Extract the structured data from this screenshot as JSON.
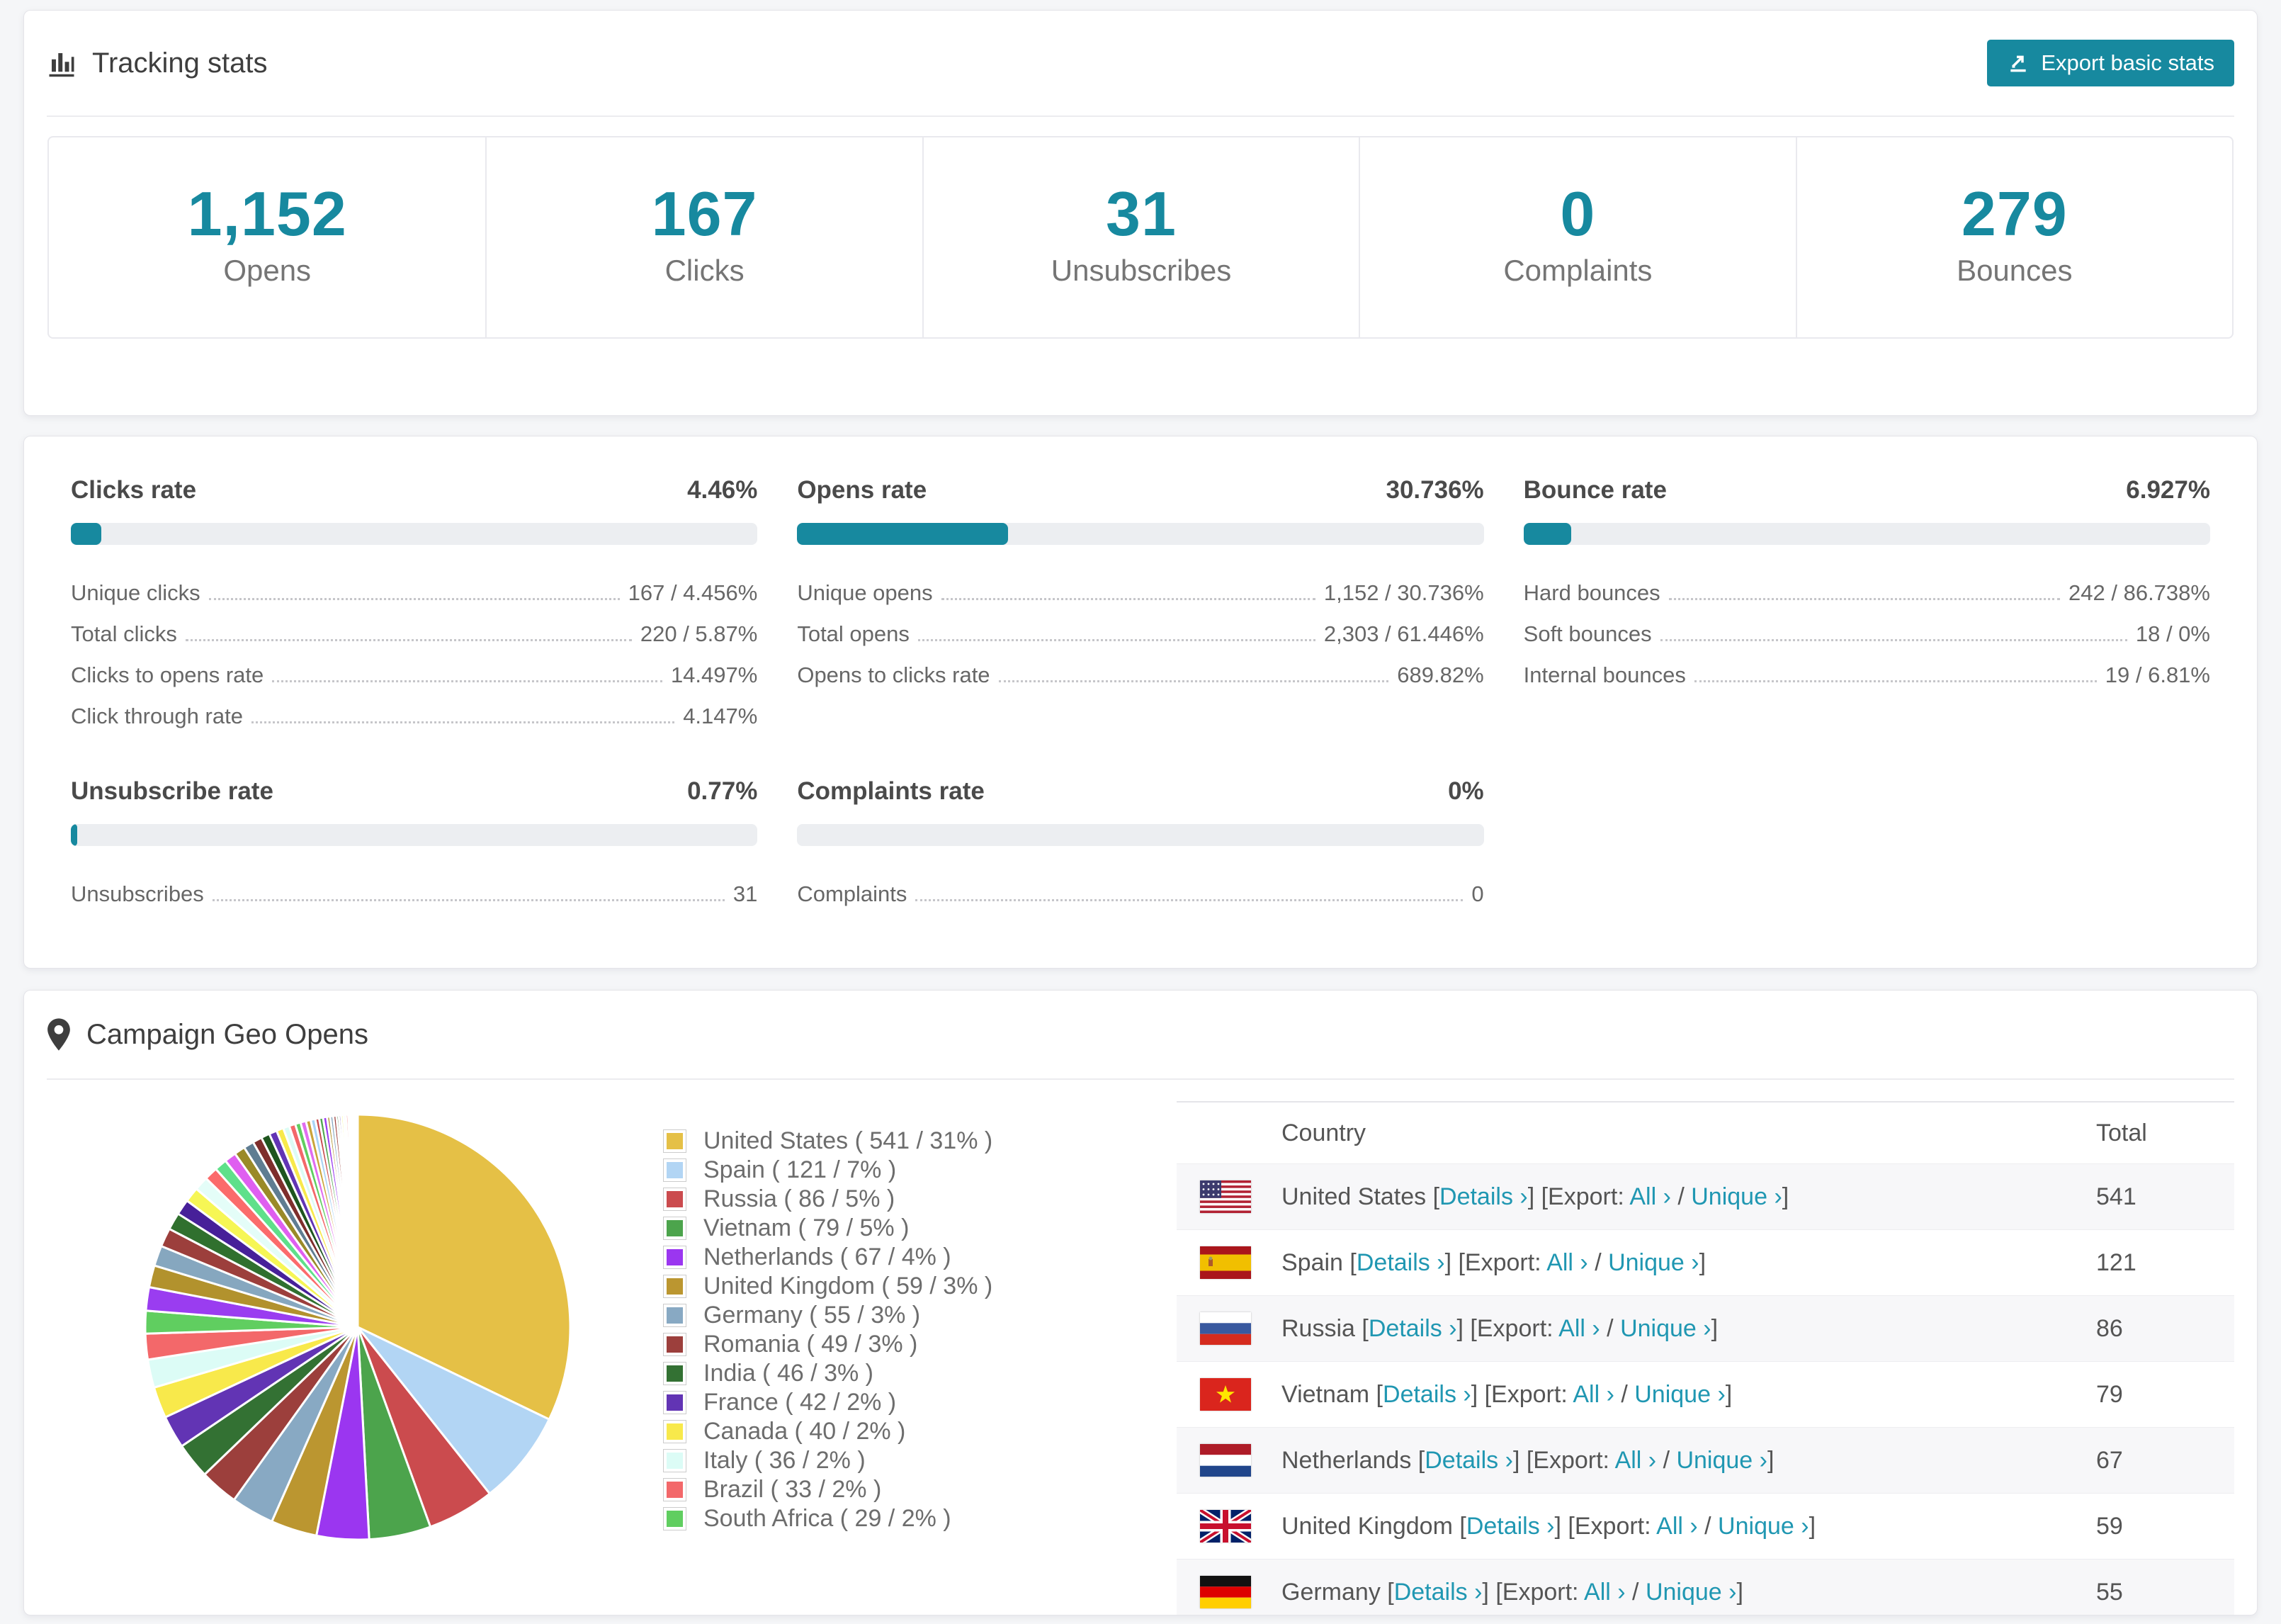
{
  "page": {
    "background": "#f5f6f8",
    "accent": "#17899f",
    "link_color": "#2097b2"
  },
  "tracking": {
    "title": "Tracking stats",
    "export_button": "Export basic stats",
    "stats": [
      {
        "value": "1,152",
        "label": "Opens"
      },
      {
        "value": "167",
        "label": "Clicks"
      },
      {
        "value": "31",
        "label": "Unsubscribes"
      },
      {
        "value": "0",
        "label": "Complaints"
      },
      {
        "value": "279",
        "label": "Bounces"
      }
    ]
  },
  "rates": {
    "row1": [
      {
        "id": "clicks",
        "title": "Clicks rate",
        "rate": "4.46%",
        "percent": 4.46,
        "rows": [
          {
            "label": "Unique clicks",
            "value": "167 / 4.456%"
          },
          {
            "label": "Total clicks",
            "value": "220 / 5.87%"
          },
          {
            "label": "Clicks to opens rate",
            "value": "14.497%"
          },
          {
            "label": "Click through rate",
            "value": "4.147%"
          }
        ]
      },
      {
        "id": "opens",
        "title": "Opens rate",
        "rate": "30.736%",
        "percent": 30.736,
        "rows": [
          {
            "label": "Unique opens",
            "value": "1,152 / 30.736%"
          },
          {
            "label": "Total opens",
            "value": "2,303 / 61.446%"
          },
          {
            "label": "Opens to clicks rate",
            "value": "689.82%"
          }
        ]
      },
      {
        "id": "bounce",
        "title": "Bounce rate",
        "rate": "6.927%",
        "percent": 6.927,
        "rows": [
          {
            "label": "Hard bounces",
            "value": "242 / 86.738%"
          },
          {
            "label": "Soft bounces",
            "value": "18 / 0%"
          },
          {
            "label": "Internal bounces",
            "value": "19 / 6.81%"
          }
        ]
      }
    ],
    "row2": [
      {
        "id": "unsubscribe",
        "title": "Unsubscribe rate",
        "rate": "0.77%",
        "percent": 0.77,
        "rows": [
          {
            "label": "Unsubscribes",
            "value": "31"
          }
        ]
      },
      {
        "id": "complaints",
        "title": "Complaints rate",
        "rate": "0%",
        "percent": 0,
        "rows": [
          {
            "label": "Complaints",
            "value": "0"
          }
        ]
      }
    ]
  },
  "geo": {
    "title": "Campaign Geo Opens",
    "table": {
      "headers": {
        "country": "Country",
        "total": "Total"
      },
      "details_label": "Details ›",
      "export_label": "Export:",
      "all_label": "All ›",
      "unique_label": "Unique ›",
      "rows": [
        {
          "flag": "us",
          "country": "United States",
          "total": "541"
        },
        {
          "flag": "es",
          "country": "Spain",
          "total": "121"
        },
        {
          "flag": "ru",
          "country": "Russia",
          "total": "86"
        },
        {
          "flag": "vn",
          "country": "Vietnam",
          "total": "79"
        },
        {
          "flag": "nl",
          "country": "Netherlands",
          "total": "67"
        },
        {
          "flag": "gb",
          "country": "United Kingdom",
          "total": "59"
        },
        {
          "flag": "de",
          "country": "Germany",
          "total": "55"
        }
      ]
    }
  },
  "chart_data": {
    "type": "pie",
    "title": "Campaign Geo Opens",
    "legend_position": "right",
    "start_angle_deg": -90,
    "countries": [
      {
        "label": "United States",
        "value": 541,
        "pct": "31%",
        "color": "#e5c046"
      },
      {
        "label": "Spain",
        "value": 121,
        "pct": "7%",
        "color": "#b2d5f4"
      },
      {
        "label": "Russia",
        "value": 86,
        "pct": "5%",
        "color": "#cb4b4e"
      },
      {
        "label": "Vietnam",
        "value": 79,
        "pct": "5%",
        "color": "#4ca44c"
      },
      {
        "label": "Netherlands",
        "value": 67,
        "pct": "4%",
        "color": "#9b36f0"
      },
      {
        "label": "United Kingdom",
        "value": 59,
        "pct": "3%",
        "color": "#bb9630"
      },
      {
        "label": "Germany",
        "value": 55,
        "pct": "3%",
        "color": "#88a9c3"
      },
      {
        "label": "Romania",
        "value": 49,
        "pct": "3%",
        "color": "#9c3f3c"
      },
      {
        "label": "India",
        "value": 46,
        "pct": "3%",
        "color": "#337133"
      },
      {
        "label": "France",
        "value": 42,
        "pct": "2%",
        "color": "#6234b4"
      },
      {
        "label": "Canada",
        "value": 40,
        "pct": "2%",
        "color": "#f8e94b"
      },
      {
        "label": "Italy",
        "value": 36,
        "pct": "2%",
        "color": "#dcfcf6"
      },
      {
        "label": "Brazil",
        "value": 33,
        "pct": "2%",
        "color": "#f3686a"
      },
      {
        "label": "South Africa",
        "value": 29,
        "pct": "2%",
        "color": "#60ce60"
      }
    ],
    "others": [
      {
        "color": "#9a3df0",
        "value": 30
      },
      {
        "color": "#b2922d",
        "value": 28
      },
      {
        "color": "#86a7bf",
        "value": 26
      },
      {
        "color": "#9c3f3c",
        "value": 24
      },
      {
        "color": "#30702e",
        "value": 22
      },
      {
        "color": "#472099",
        "value": 20
      },
      {
        "color": "#f6f655",
        "value": 19
      },
      {
        "color": "#e4fdf8",
        "value": 18
      },
      {
        "color": "#fb6b6b",
        "value": 17
      },
      {
        "color": "#5fe08a",
        "value": 16
      },
      {
        "color": "#df5ff0",
        "value": 15
      },
      {
        "color": "#9a8a28",
        "value": 14
      },
      {
        "color": "#5f7d92",
        "value": 13
      },
      {
        "color": "#7e2e2c",
        "value": 12
      },
      {
        "color": "#1e551e",
        "value": 11
      },
      {
        "color": "#6234b4",
        "value": 10
      },
      {
        "color": "#f8e94b",
        "value": 9
      },
      {
        "color": "#dcfcf6",
        "value": 8
      },
      {
        "color": "#f3686a",
        "value": 8
      },
      {
        "color": "#60ce60",
        "value": 7
      },
      {
        "color": "#e06df0",
        "value": 7
      },
      {
        "color": "#caa43a",
        "value": 6
      },
      {
        "color": "#aad4f5",
        "value": 6
      },
      {
        "color": "#c84a4d",
        "value": 5
      },
      {
        "color": "#4fa74f",
        "value": 5
      },
      {
        "color": "#9a3df0",
        "value": 5
      },
      {
        "color": "#b2922d",
        "value": 4
      },
      {
        "color": "#86a7bf",
        "value": 4
      },
      {
        "color": "#9c3f3c",
        "value": 4
      },
      {
        "color": "#30702e",
        "value": 3
      },
      {
        "color": "#472099",
        "value": 3
      },
      {
        "color": "#f6f655",
        "value": 3
      },
      {
        "color": "#e4fdf8",
        "value": 3
      },
      {
        "color": "#fb6b6b",
        "value": 3
      },
      {
        "color": "#5fe08a",
        "value": 2
      },
      {
        "color": "#df5ff0",
        "value": 2
      },
      {
        "color": "#caa43a",
        "value": 2
      },
      {
        "color": "#aad4f5",
        "value": 2
      },
      {
        "color": "#c84a4d",
        "value": 2
      },
      {
        "color": "#4fa74f",
        "value": 2
      }
    ]
  }
}
